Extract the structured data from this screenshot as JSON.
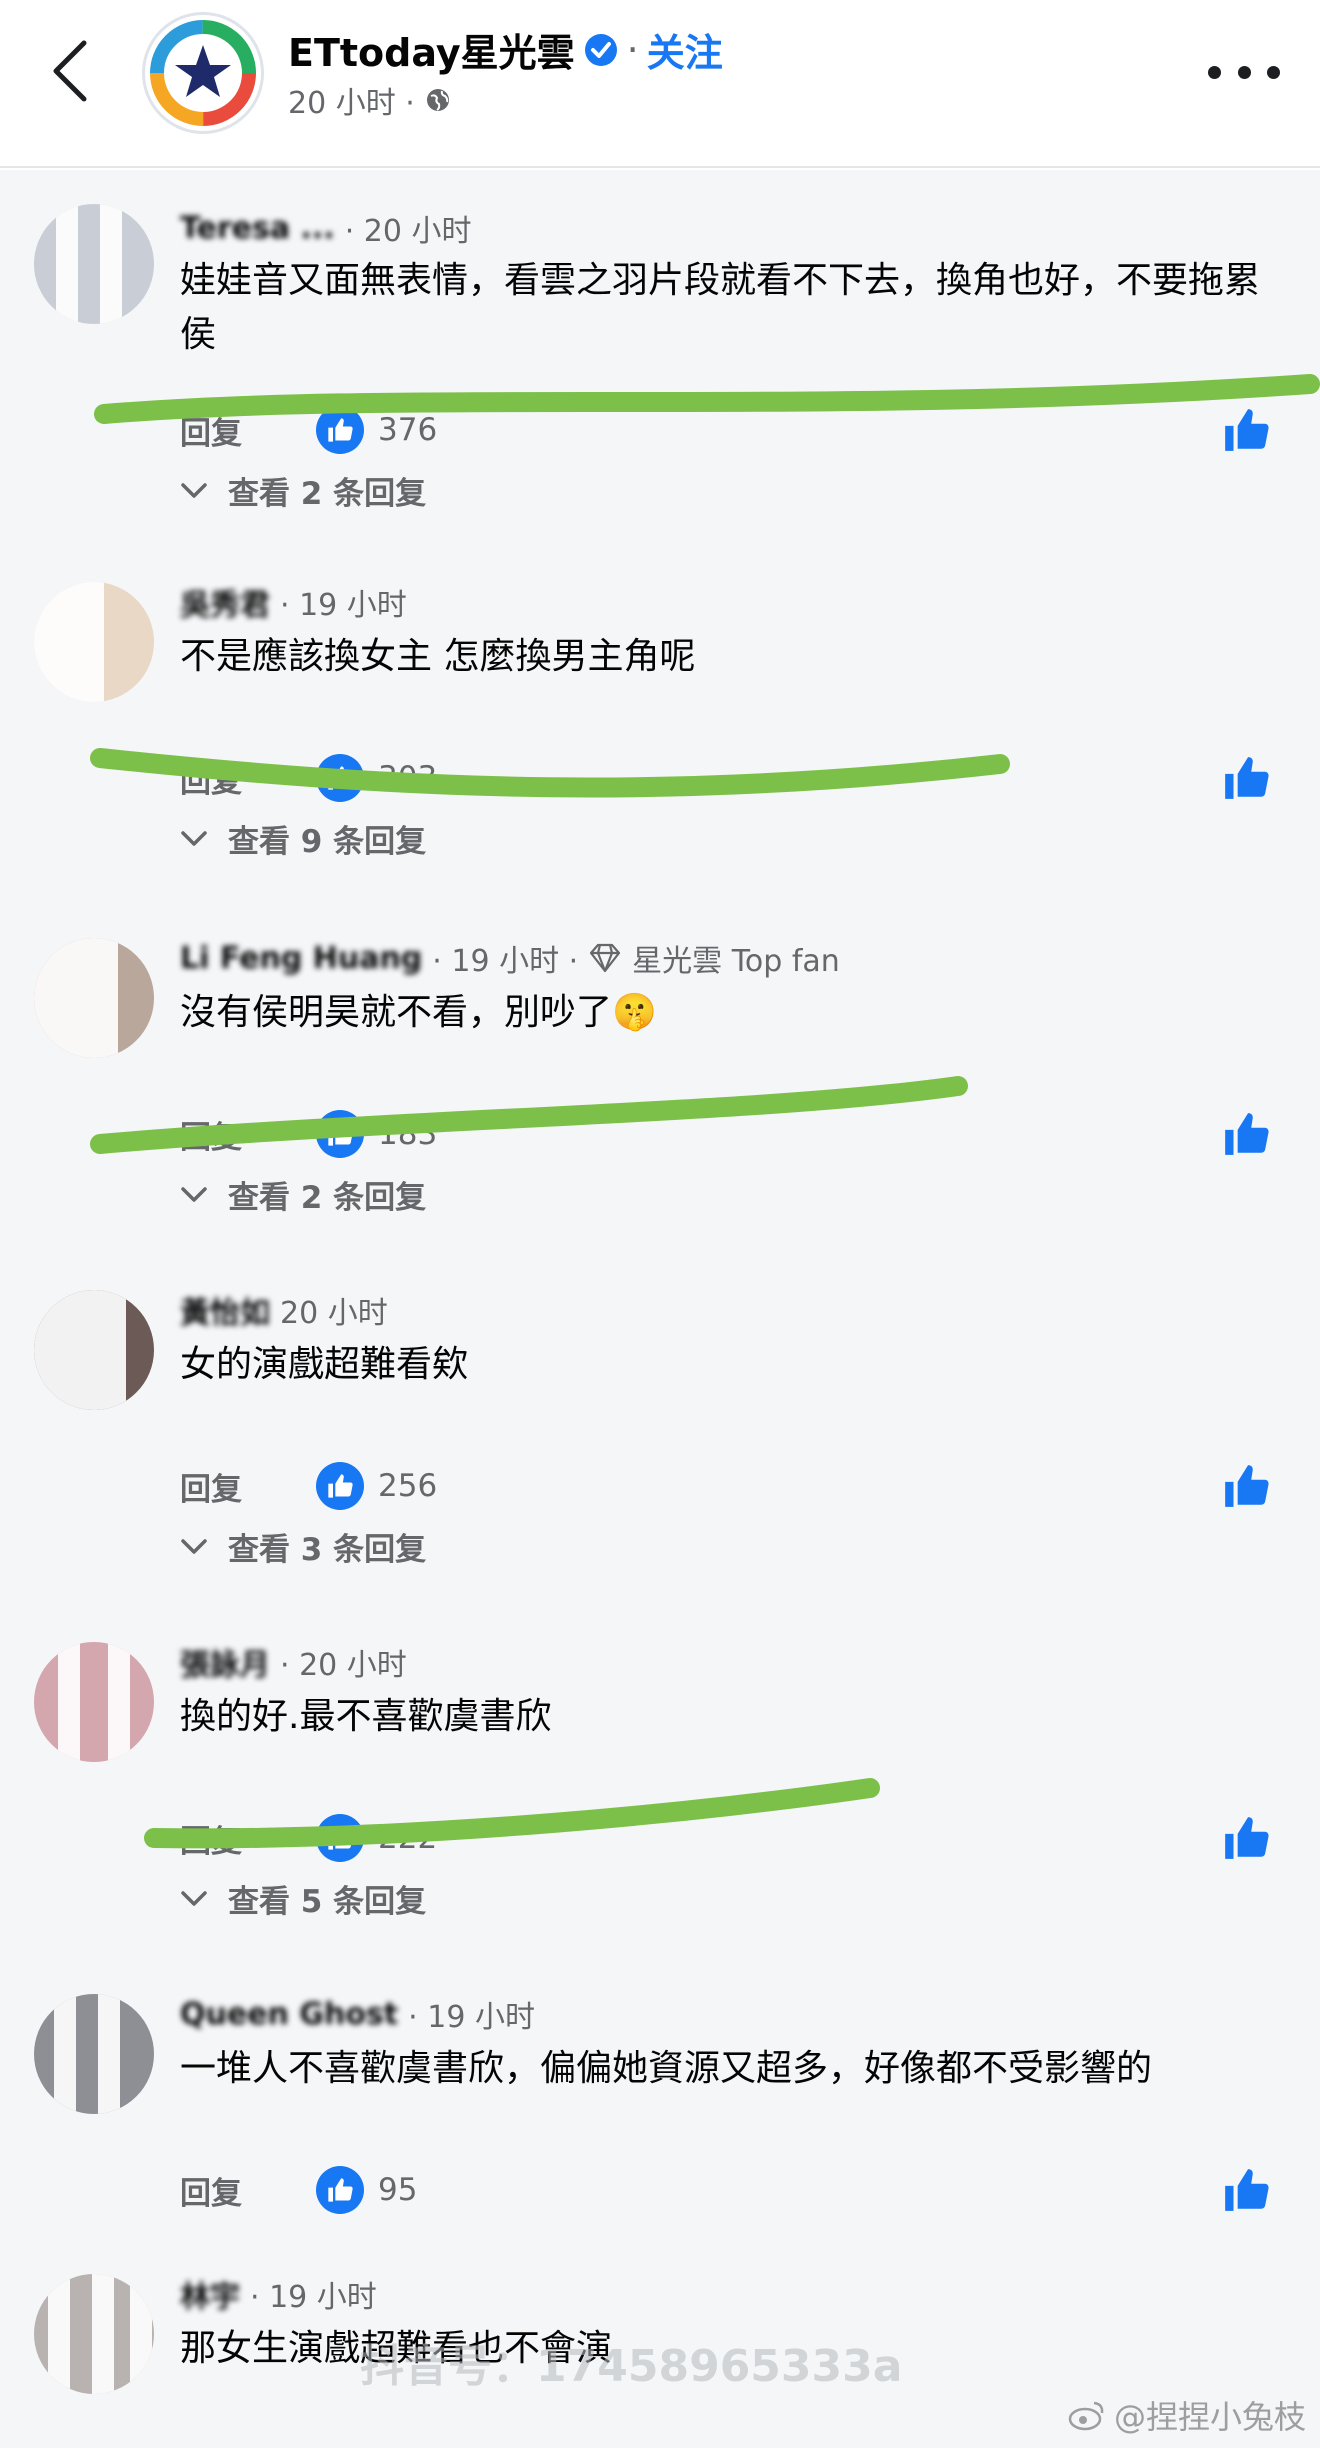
{
  "header": {
    "page_name": "ETtoday星光雲",
    "separator": "·",
    "follow_label": "关注",
    "time": "20 小时 ·"
  },
  "colors": {
    "accent": "#1877f2",
    "marker": "#7cc04a",
    "secondary_text": "#65676b"
  },
  "comments": [
    {
      "author": "Teresa ...",
      "time": "· 20 小时",
      "text": "娃娃音又面無表情，看雲之羽片段就看不下去，換角也好，不要拖累侯",
      "reply_label": "回复",
      "likes": "376",
      "view_replies": "查看 2 条回复"
    },
    {
      "author": "吳秀君",
      "time": "· 19 小时",
      "text": "不是應該換女主 怎麼換男主角呢",
      "reply_label": "回复",
      "likes": "303",
      "view_replies": "查看 9 条回复"
    },
    {
      "author": "Li Feng Huang",
      "time": "· 19 小时 ·",
      "badge_text": "星光雲 Top fan",
      "text": "沒有侯明昊就不看，別吵了🤫",
      "reply_label": "回复",
      "likes": "183",
      "view_replies": "查看 2 条回复"
    },
    {
      "author": "黃怡如",
      "time": "20 小时",
      "text": "女的演戲超難看欸",
      "reply_label": "回复",
      "likes": "256",
      "view_replies": "查看 3 条回复"
    },
    {
      "author": "張詠月",
      "time": "· 20 小时",
      "text": "換的好.最不喜歡虞書欣",
      "reply_label": "回复",
      "likes": "222",
      "view_replies": "查看 5 条回复"
    },
    {
      "author": "Queen Ghost",
      "time": "· 19 小时",
      "text": "一堆人不喜歡虞書欣，偏偏她資源又超多，好像都不受影響的",
      "reply_label": "回复",
      "likes": "95"
    },
    {
      "author": "林宇",
      "time": "· 19 小时",
      "text": "那女生演戲超難看也不會演"
    }
  ],
  "watermark": "抖音号：17458965333a",
  "weibo_credit": "@捏捏小兔枝"
}
